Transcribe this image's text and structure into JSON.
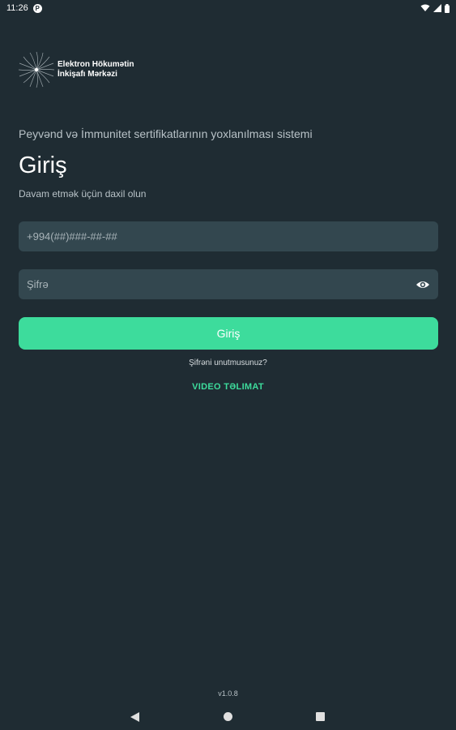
{
  "status_bar": {
    "time": "11:26",
    "app_badge": "P"
  },
  "header": {
    "logo_line1": "Elektron Hökumətin",
    "logo_line2": "İnkişafı Mərkəzi"
  },
  "main": {
    "subtitle": "Peyvənd və İmmunitet sertifikatlarının yoxlanılması sistemi",
    "title": "Giriş",
    "instruction": "Davam etmək üçün daxil olun",
    "phone_placeholder": "+994(##)###-##-##",
    "password_placeholder": "Şifrə",
    "login_label": "Giriş",
    "forgot_label": "Şifrəni unutmusunuz?",
    "video_label": "VIDEO TƏLIMAT"
  },
  "footer": {
    "version": "v1.0.8"
  },
  "colors": {
    "background": "#1f2c33",
    "field": "#33474f",
    "accent": "#3ddc9c"
  },
  "icons": {
    "password_toggle": "eye-icon",
    "logo": "burst-logo-icon"
  }
}
